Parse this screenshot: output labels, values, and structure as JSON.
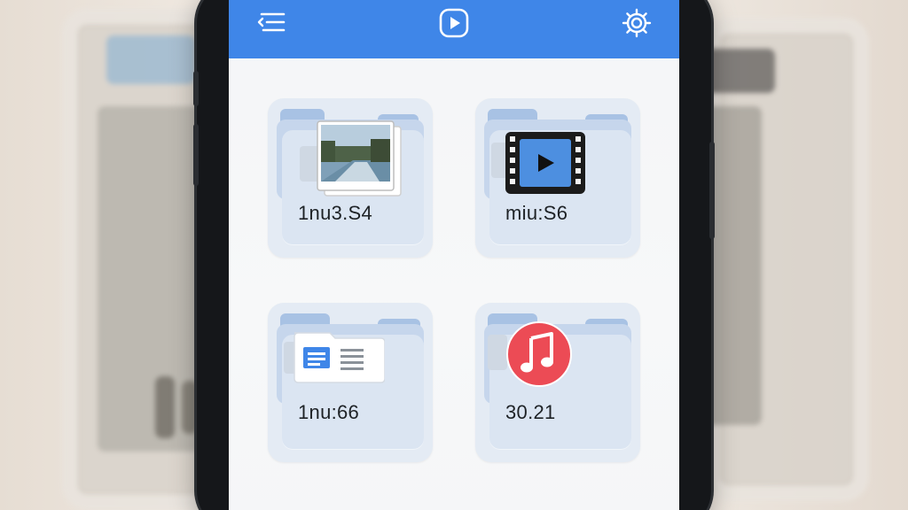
{
  "appbar": {
    "menu_icon": "menu-back-icon",
    "center_icon": "play-icon",
    "settings_icon": "gear-icon",
    "color": "#3f86e8"
  },
  "folders": [
    {
      "label": "1nu3.S4",
      "icon": "photos-icon"
    },
    {
      "label": "miu:S6",
      "icon": "video-icon"
    },
    {
      "label": "1nu:66",
      "icon": "document-icon"
    },
    {
      "label": "30.21",
      "icon": "music-icon"
    }
  ]
}
